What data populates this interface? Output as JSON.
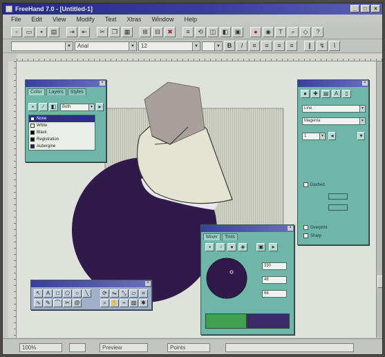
{
  "window": {
    "title": "FreeHand 7.0 - [Untitled-1]"
  },
  "menu": [
    "File",
    "Edit",
    "View",
    "Modify",
    "Text",
    "Xtras",
    "Window",
    "Help"
  ],
  "toolbar": {
    "font_name": "Arial",
    "font_size": "12",
    "bold": "B",
    "italic": "I"
  },
  "color_list": {
    "tabs": [
      "Color",
      "Layers",
      "Styles"
    ],
    "mode": "Both",
    "items": [
      {
        "name": "None",
        "color": "#ffffff",
        "selected": true
      },
      {
        "name": "White",
        "color": "#ffffff"
      },
      {
        "name": "Black",
        "color": "#000000"
      },
      {
        "name": "Registration",
        "color": "#111111"
      },
      {
        "name": "Aubergine",
        "color": "#3a1b52"
      }
    ]
  },
  "stroke_inspector": {
    "stroke_type": "Line",
    "ink": "Magenta",
    "width": "1",
    "checkbox_label": "Dashed",
    "option1": "Overprint",
    "option2": "Sharp"
  },
  "mixer": {
    "tabs": [
      "Mixer",
      "Tints"
    ],
    "values": [
      "330",
      "48",
      "66"
    ]
  },
  "status": {
    "zoom": "100%",
    "view_mode": "Preview",
    "units": "Points"
  },
  "colors": {
    "title_bar": "#242a8a",
    "palette_bg": "#6fb6a8",
    "dark_purple": "#2f1a4a",
    "gray_shape": "#a8a09c",
    "mixer_green": "#3fa050",
    "mixer_purple": "#3b2a6a"
  }
}
